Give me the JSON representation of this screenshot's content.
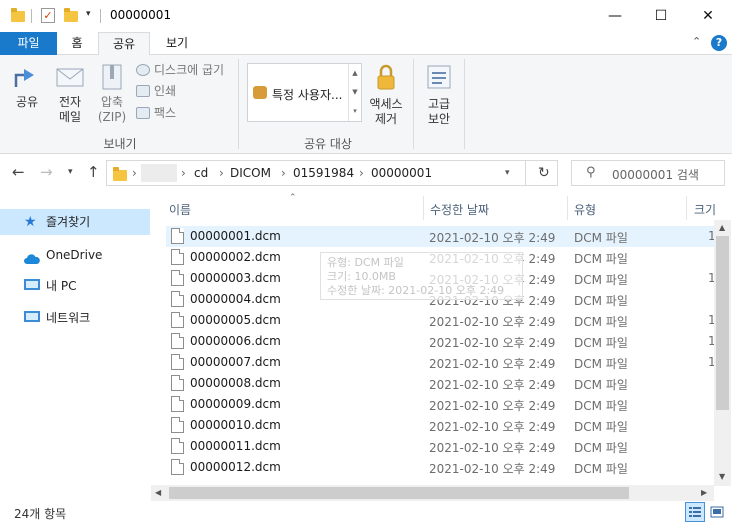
{
  "window": {
    "title": "00000001",
    "minimize": "—",
    "maximize": "☐",
    "close": "✕"
  },
  "ribbon_tabs": {
    "file": "파일",
    "home": "홈",
    "share": "공유",
    "view": "보기",
    "collapse": "⌃",
    "help": "?"
  },
  "ribbon": {
    "share_btn": "공유",
    "email_btn": "전자\n메일",
    "zip_btn": "압축\n(ZIP)",
    "burn_disc": "디스크에 굽기",
    "print": "인쇄",
    "fax": "팩스",
    "send_group": "보내기",
    "share_with_combo": "특정 사용자...",
    "share_group": "공유 대상",
    "access_btn": "액세스\n제거",
    "advanced_btn": "고급\n보안"
  },
  "address": {
    "crumbs": [
      "cd",
      "DICOM",
      "01591984",
      "00000001"
    ],
    "search_placeholder": "00000001 검색"
  },
  "nav_pane": {
    "quick_access": "즐겨찾기",
    "onedrive": "OneDrive",
    "this_pc": "내 PC",
    "network": "네트워크"
  },
  "columns": {
    "name": "이름",
    "date": "수정한 날짜",
    "type": "유형",
    "size": "크기"
  },
  "files": [
    {
      "name": "00000001.dcm",
      "date": "2021-02-10 오후 2:49",
      "type": "DCM 파일",
      "size": "1"
    },
    {
      "name": "00000002.dcm",
      "date": "2021-02-10 오후 2:49",
      "type": "DCM 파일",
      "size": ""
    },
    {
      "name": "00000003.dcm",
      "date": "2021-02-10 오후 2:49",
      "type": "DCM 파일",
      "size": "1"
    },
    {
      "name": "00000004.dcm",
      "date": "2021-02-10 오후 2:49",
      "type": "DCM 파일",
      "size": ""
    },
    {
      "name": "00000005.dcm",
      "date": "2021-02-10 오후 2:49",
      "type": "DCM 파일",
      "size": "1"
    },
    {
      "name": "00000006.dcm",
      "date": "2021-02-10 오후 2:49",
      "type": "DCM 파일",
      "size": "1"
    },
    {
      "name": "00000007.dcm",
      "date": "2021-02-10 오후 2:49",
      "type": "DCM 파일",
      "size": "1"
    },
    {
      "name": "00000008.dcm",
      "date": "2021-02-10 오후 2:49",
      "type": "DCM 파일",
      "size": ""
    },
    {
      "name": "00000009.dcm",
      "date": "2021-02-10 오후 2:49",
      "type": "DCM 파일",
      "size": ""
    },
    {
      "name": "00000010.dcm",
      "date": "2021-02-10 오후 2:49",
      "type": "DCM 파일",
      "size": ""
    },
    {
      "name": "00000011.dcm",
      "date": "2021-02-10 오후 2:49",
      "type": "DCM 파일",
      "size": ""
    },
    {
      "name": "00000012.dcm",
      "date": "2021-02-10 오후 2:49",
      "type": "DCM 파일",
      "size": ""
    }
  ],
  "tooltip": {
    "line1": "유형: DCM 파일",
    "line2": "크기: 10.0MB",
    "line3": "수정한 날짜: 2021-02-10 오후 2:49"
  },
  "status": {
    "count": "24개 항목"
  }
}
